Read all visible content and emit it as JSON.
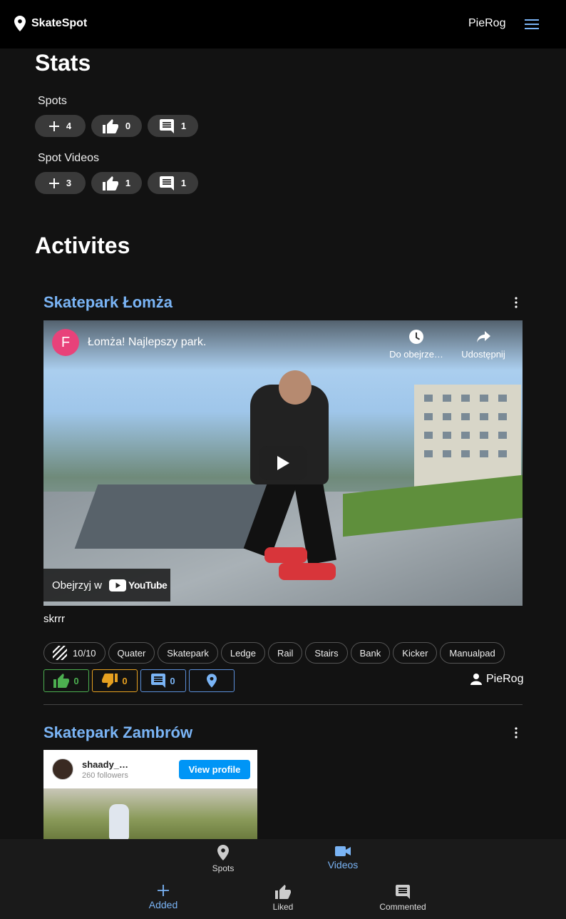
{
  "app": {
    "brand": "SkateSpot",
    "user": "PieRog"
  },
  "stats": {
    "title": "Stats",
    "spots": {
      "label": "Spots",
      "added": "4",
      "liked": "0",
      "commented": "1"
    },
    "videos": {
      "label": "Spot Videos",
      "added": "3",
      "liked": "1",
      "commented": "1"
    }
  },
  "activities": {
    "title": "Activites",
    "post1": {
      "title": "Skatepark Łomża",
      "video": {
        "channel_initial": "F",
        "title": "Łomża! Najlepszy park.",
        "watch_later": "Do obejrze…",
        "share": "Udostępnij",
        "watch_on": "Obejrzyj w",
        "youtube": "YouTube"
      },
      "description": "skrrr",
      "rating": "10/10",
      "tags": [
        "Quater",
        "Skatepark",
        "Ledge",
        "Rail",
        "Stairs",
        "Bank",
        "Kicker",
        "Manualpad"
      ],
      "likes": "0",
      "dislikes": "0",
      "comments": "0",
      "author": "PieRog"
    },
    "post2": {
      "title": "Skatepark Zambrów",
      "embed": {
        "name": "shaady_…",
        "followers": "260 followers",
        "button": "View profile"
      }
    }
  },
  "bottom_nav": {
    "spots": "Spots",
    "videos": "Videos",
    "added": "Added",
    "liked": "Liked",
    "commented": "Commented"
  }
}
